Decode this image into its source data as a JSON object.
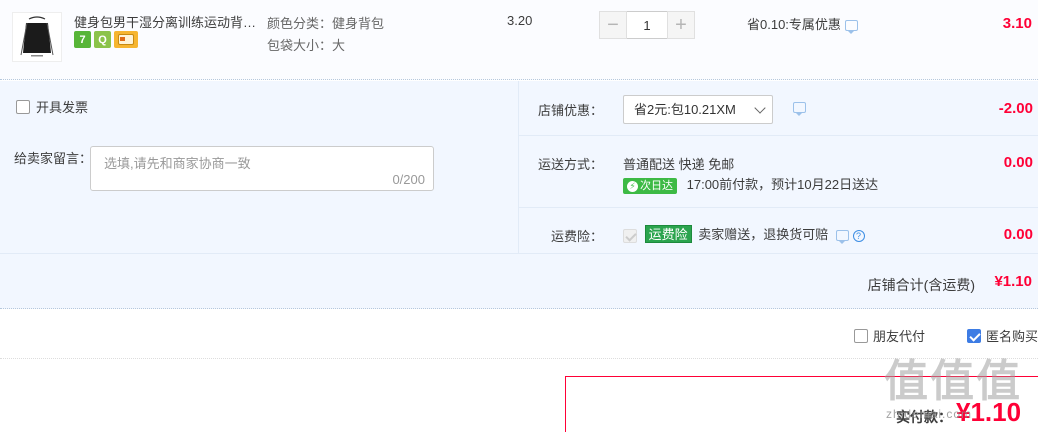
{
  "item": {
    "title": "健身包男干湿分离训练运动背包...",
    "badges": [
      "7",
      "Q",
      ""
    ],
    "sku": [
      {
        "label": "颜色分类：",
        "value": "健身背包"
      },
      {
        "label": "包袋大小：",
        "value": "大"
      }
    ],
    "price": "3.20",
    "qty": "1",
    "qty_minus": "−",
    "qty_plus": "+",
    "discount": "省0.10:专属优惠",
    "total": "3.10"
  },
  "order": {
    "invoice_label": "开具发票",
    "memo_label": "给卖家留言：",
    "memo_placeholder": "选填,请先和商家协商一致",
    "memo_counter": "0/200",
    "shop_discount": {
      "label": "店铺优惠：",
      "selected": "省2元:包10.21XM",
      "amount": "-2.00"
    },
    "shipping": {
      "label": "运送方式：",
      "method": "普通配送 快递 免邮",
      "tag": "次日达",
      "tag_icon": "bolt",
      "note": "17:00前付款，预计10月22日送达",
      "amount": "0.00"
    },
    "insurance": {
      "label": "运费险：",
      "tag": "运费险",
      "text": "卖家赠送，退换货可赔",
      "help": "?",
      "amount": "0.00"
    },
    "store_total_label": "店铺合计(含运费)",
    "store_total": "¥1.10"
  },
  "options": {
    "friend_pay": "朋友代付",
    "anonymous": "匿名购买"
  },
  "pay": {
    "label": "实付款：",
    "amount": "¥1.10"
  },
  "watermark": {
    "big": "值值值",
    "small": "zhidemai.com"
  },
  "colors": {
    "accent_red": "#ff0036",
    "checkbox_blue": "#3d7ce4",
    "green_tag": "#3dba45",
    "panel_bg": "#f2f7ff"
  }
}
